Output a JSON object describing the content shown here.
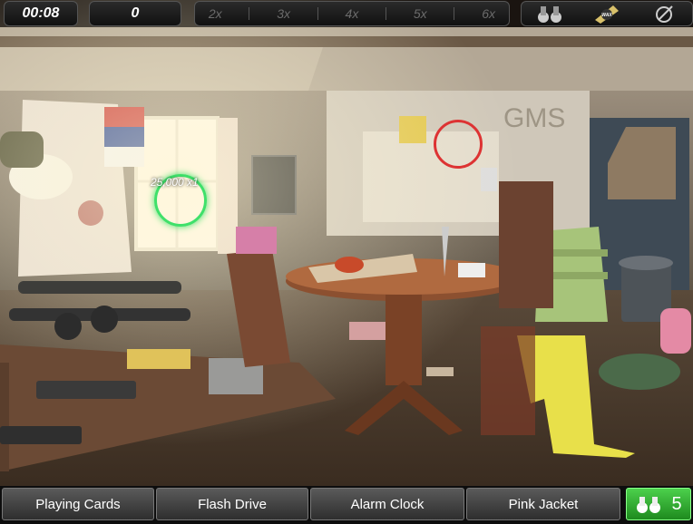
{
  "hud": {
    "timer": "00:08",
    "score": "0",
    "multipliers": [
      "2x",
      "3x",
      "4x",
      "5x",
      "6x"
    ],
    "tools": [
      {
        "icon": "binoculars-icon"
      },
      {
        "icon": "wax-icon",
        "label": "WAX"
      },
      {
        "icon": "compass-icon"
      }
    ]
  },
  "scene": {
    "popup_points": "25,000",
    "popup_multiplier": "x1"
  },
  "items": [
    "Playing Cards",
    "Flash Drive",
    "Alarm Clock",
    "Pink Jacket"
  ],
  "hint": {
    "count": "5",
    "icon": "binoculars-icon"
  },
  "colors": {
    "hint_green": "#2eb82e",
    "found_ring": "#3fe06a",
    "target_ring": "#dd3333"
  }
}
